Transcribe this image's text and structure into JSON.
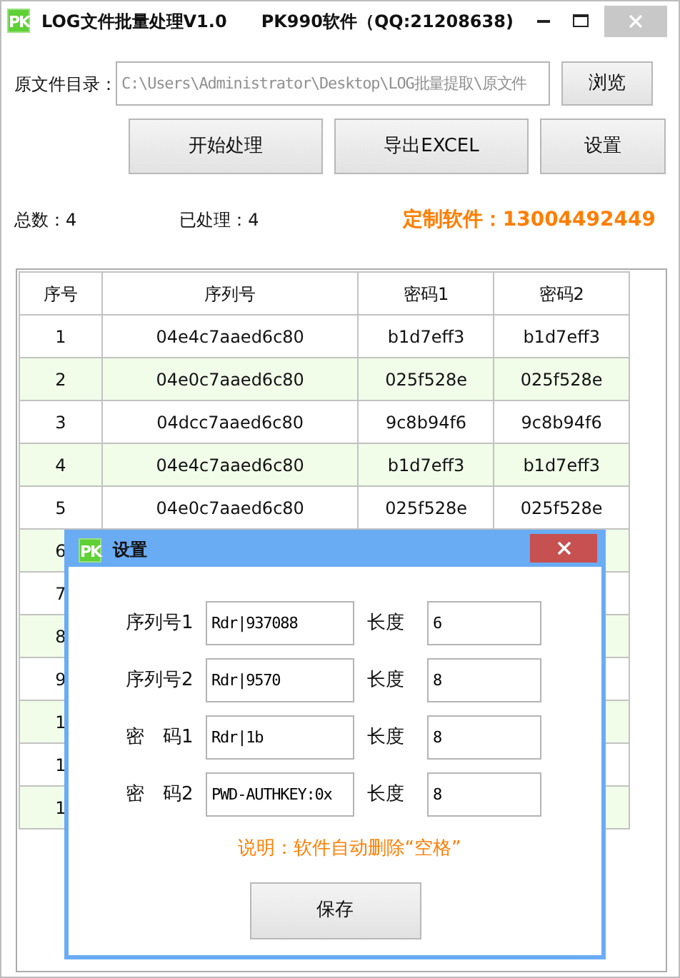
{
  "window": {
    "app_icon": "PK",
    "title": "LOG文件批量处理V1.0",
    "subtitle": "PK990软件（QQ:21208638)"
  },
  "source_dir": {
    "label": "原文件目录：",
    "value": "C:\\Users\\Administrator\\Desktop\\LOG批量提取\\原文件",
    "readonly": true,
    "browse": "浏览"
  },
  "actions": [
    "开始处理",
    "导出EXCEL",
    "设置"
  ],
  "stats": {
    "total_label": "总数：",
    "total": "4",
    "processed_label": "已处理：",
    "processed": "4",
    "contact": "定制软件：13004492449"
  },
  "table": {
    "columns": [
      "序号",
      "序列号",
      "密码1",
      "密码2"
    ],
    "rows": [
      {
        "no": "1",
        "serial": "04e4c7aaed6c80",
        "pwd1": "b1d7eff3",
        "pwd2": "b1d7eff3"
      },
      {
        "no": "2",
        "serial": "04e0c7aaed6c80",
        "pwd1": "025f528e",
        "pwd2": "025f528e"
      },
      {
        "no": "3",
        "serial": "04dcc7aaed6c80",
        "pwd1": "9c8b94f6",
        "pwd2": "9c8b94f6"
      },
      {
        "no": "4",
        "serial": "04e4c7aaed6c80",
        "pwd1": "b1d7eff3",
        "pwd2": "b1d7eff3"
      },
      {
        "no": "5",
        "serial": "04e0c7aaed6c80",
        "pwd1": "025f528e",
        "pwd2": "025f528e"
      },
      {
        "no": "6"
      },
      {
        "no": "7"
      },
      {
        "no": "8"
      },
      {
        "no": "9"
      },
      {
        "no": "1"
      },
      {
        "no": "1"
      },
      {
        "no": "1"
      }
    ]
  },
  "dialog": {
    "app_icon": "PK",
    "title": "设置",
    "fields": [
      {
        "label": "序列号1",
        "value": "Rdr|937088",
        "length_label": "长度",
        "length": "6"
      },
      {
        "label": "序列号2",
        "value": "Rdr|9570",
        "length_label": "长度",
        "length": "8"
      },
      {
        "label": "密　码1",
        "value": "Rdr|1b",
        "length_label": "长度",
        "length": "8"
      },
      {
        "label": "密　码2",
        "value": "PWD-AUTHKEY:0x",
        "length_label": "长度",
        "length": "8"
      }
    ],
    "note": "说明：软件自动删除“空格”",
    "save": "保存"
  }
}
